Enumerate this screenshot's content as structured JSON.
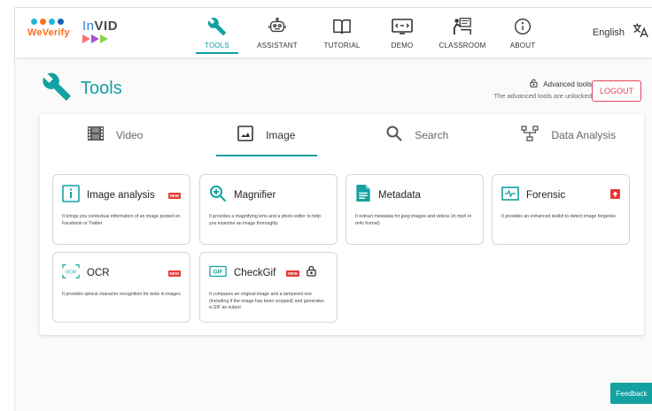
{
  "nav": {
    "tabs": [
      {
        "label": "TOOLS",
        "icon": "wrench-icon",
        "active": true
      },
      {
        "label": "ASSISTANT",
        "icon": "robot-icon",
        "active": false
      },
      {
        "label": "TUTORIAL",
        "icon": "book-icon",
        "active": false
      },
      {
        "label": "DEMO",
        "icon": "video-demo-icon",
        "active": false
      },
      {
        "label": "CLASSROOM",
        "icon": "classroom-icon",
        "active": false
      },
      {
        "label": "ABOUT",
        "icon": "info-icon",
        "active": false
      }
    ],
    "language": "English"
  },
  "logos": {
    "weverify": "WeVerify",
    "invid_in": "In",
    "invid_vid": "VID"
  },
  "header": {
    "title": "Tools",
    "advanced_tools_label": "Advanced tools",
    "advanced_status": "The advanced tools are unlocked",
    "logout_label": "LOGOUT"
  },
  "categories": [
    {
      "label": "Video",
      "icon": "film-icon",
      "active": false
    },
    {
      "label": "Image",
      "icon": "image-icon",
      "active": true
    },
    {
      "label": "Search",
      "icon": "search-icon",
      "active": false
    },
    {
      "label": "Data Analysis",
      "icon": "data-analysis-icon",
      "active": false
    }
  ],
  "tools": [
    {
      "name": "Image analysis",
      "desc": "It brings you contextual information of an image posted on Facebook or Twitter",
      "icon": "image-analysis-icon",
      "badge": "NEW"
    },
    {
      "name": "Magnifier",
      "desc": "It provides a magnifying lens and a photo editor to help you examine an image thoroughly",
      "icon": "magnifier-icon"
    },
    {
      "name": "Metadata",
      "desc": "It extract metadata for jpeg images and videos (in mp4 or m4v format)",
      "icon": "metadata-icon"
    },
    {
      "name": "Forensic",
      "desc": "It provides an enhanced toolkit to detect image forgeries",
      "icon": "forensic-icon"
    },
    {
      "name": "OCR",
      "desc": "It provides optical character recognition for texts in images",
      "icon": "ocr-icon",
      "badge": "NEW"
    },
    {
      "name": "CheckGif",
      "desc": "It compares an original image and a tampered one (including if the image has been cropped) and generates a GIF as output",
      "icon": "checkgif-icon",
      "badge": "NEW"
    }
  ],
  "feedback_label": "Feedback",
  "colors": {
    "accent": "#13a1a1",
    "logout": "#e0435a",
    "badge": "#e53935"
  }
}
